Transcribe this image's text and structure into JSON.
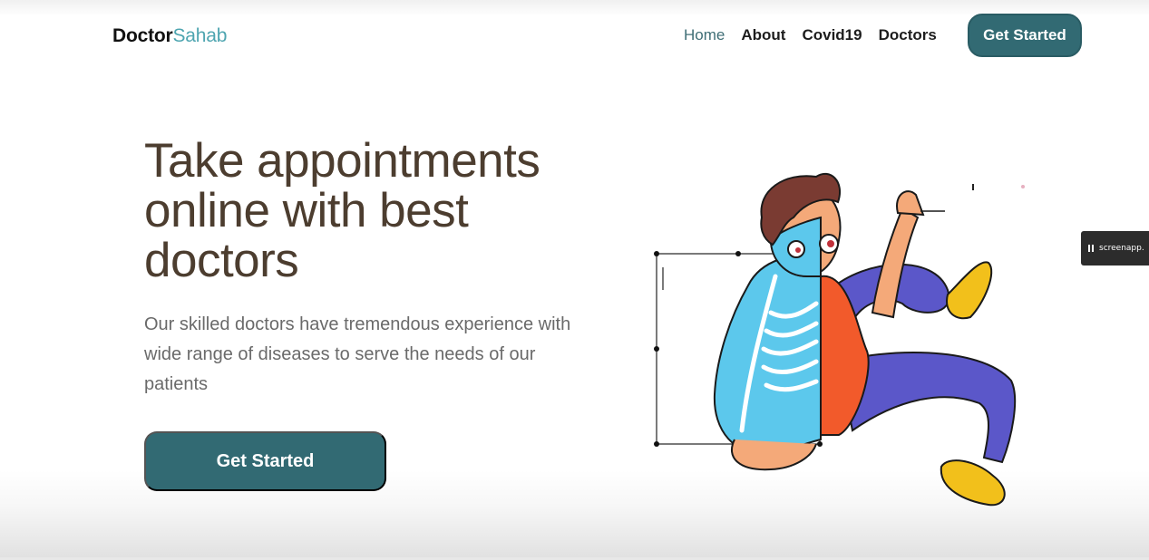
{
  "brand": {
    "name_bold": "Doctor",
    "name_accent": "Sahab"
  },
  "nav": {
    "links": [
      {
        "label": "Home",
        "active": true
      },
      {
        "label": "About",
        "active": false
      },
      {
        "label": "Covid19",
        "active": false
      },
      {
        "label": "Doctors",
        "active": false
      }
    ],
    "cta_label": "Get Started"
  },
  "hero": {
    "title_lines": [
      "Take appointments",
      "online with best",
      "doctors"
    ],
    "subtitle_lines": [
      "Our skilled doctors have tremendous experience with",
      "wide range of diseases to serve the needs of our",
      "patients"
    ],
    "cta_label": "Get Started"
  },
  "recorder_badge": {
    "label": "screenapp.",
    "icon": "pause-icon"
  },
  "colors": {
    "primary": "#326a73",
    "accent": "#4ea5b0",
    "heading": "#4c3d2f",
    "body_text": "#6a6a6a"
  }
}
